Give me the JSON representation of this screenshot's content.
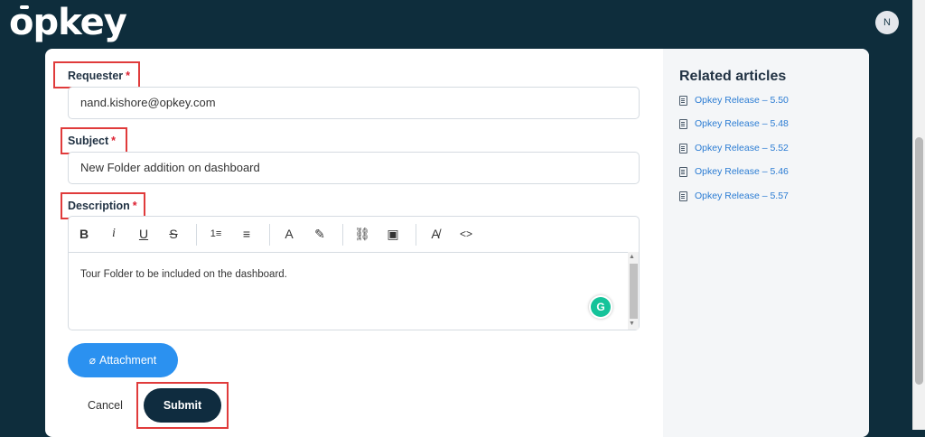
{
  "header": {
    "logo_text": "opkey",
    "avatar_initial": "N"
  },
  "form": {
    "requester_label": "Requester",
    "requester_value": "nand.kishore@opkey.com",
    "subject_label": "Subject",
    "subject_value": "New Folder addition on dashboard",
    "description_label": "Description",
    "required_mark": "*",
    "description_text": "Tour Folder to be included on the dashboard.",
    "toolbar": {
      "bold": "B",
      "italic": "i",
      "underline": "U",
      "strike": "S",
      "ordered_list": "1≡",
      "bullet_list": "≡",
      "text_color": "A",
      "highlight": "✎",
      "link": "⛓",
      "image": "▣",
      "clear_format": "A̸",
      "code": "<>"
    },
    "grammarly_letter": "G",
    "attachment_label": "Attachment",
    "cancel_label": "Cancel",
    "submit_label": "Submit"
  },
  "sidebar": {
    "title": "Related articles",
    "articles": [
      "Opkey Release – 5.50",
      "Opkey Release – 5.48",
      "Opkey Release – 5.52",
      "Opkey Release – 5.46",
      "Opkey Release – 5.57"
    ]
  },
  "colors": {
    "header_bg": "#0e2d3c",
    "accent": "#2b91f0",
    "submit_bg": "#0f2c3f",
    "highlight_box": "#e03b3b",
    "link": "#2b7cd3"
  }
}
